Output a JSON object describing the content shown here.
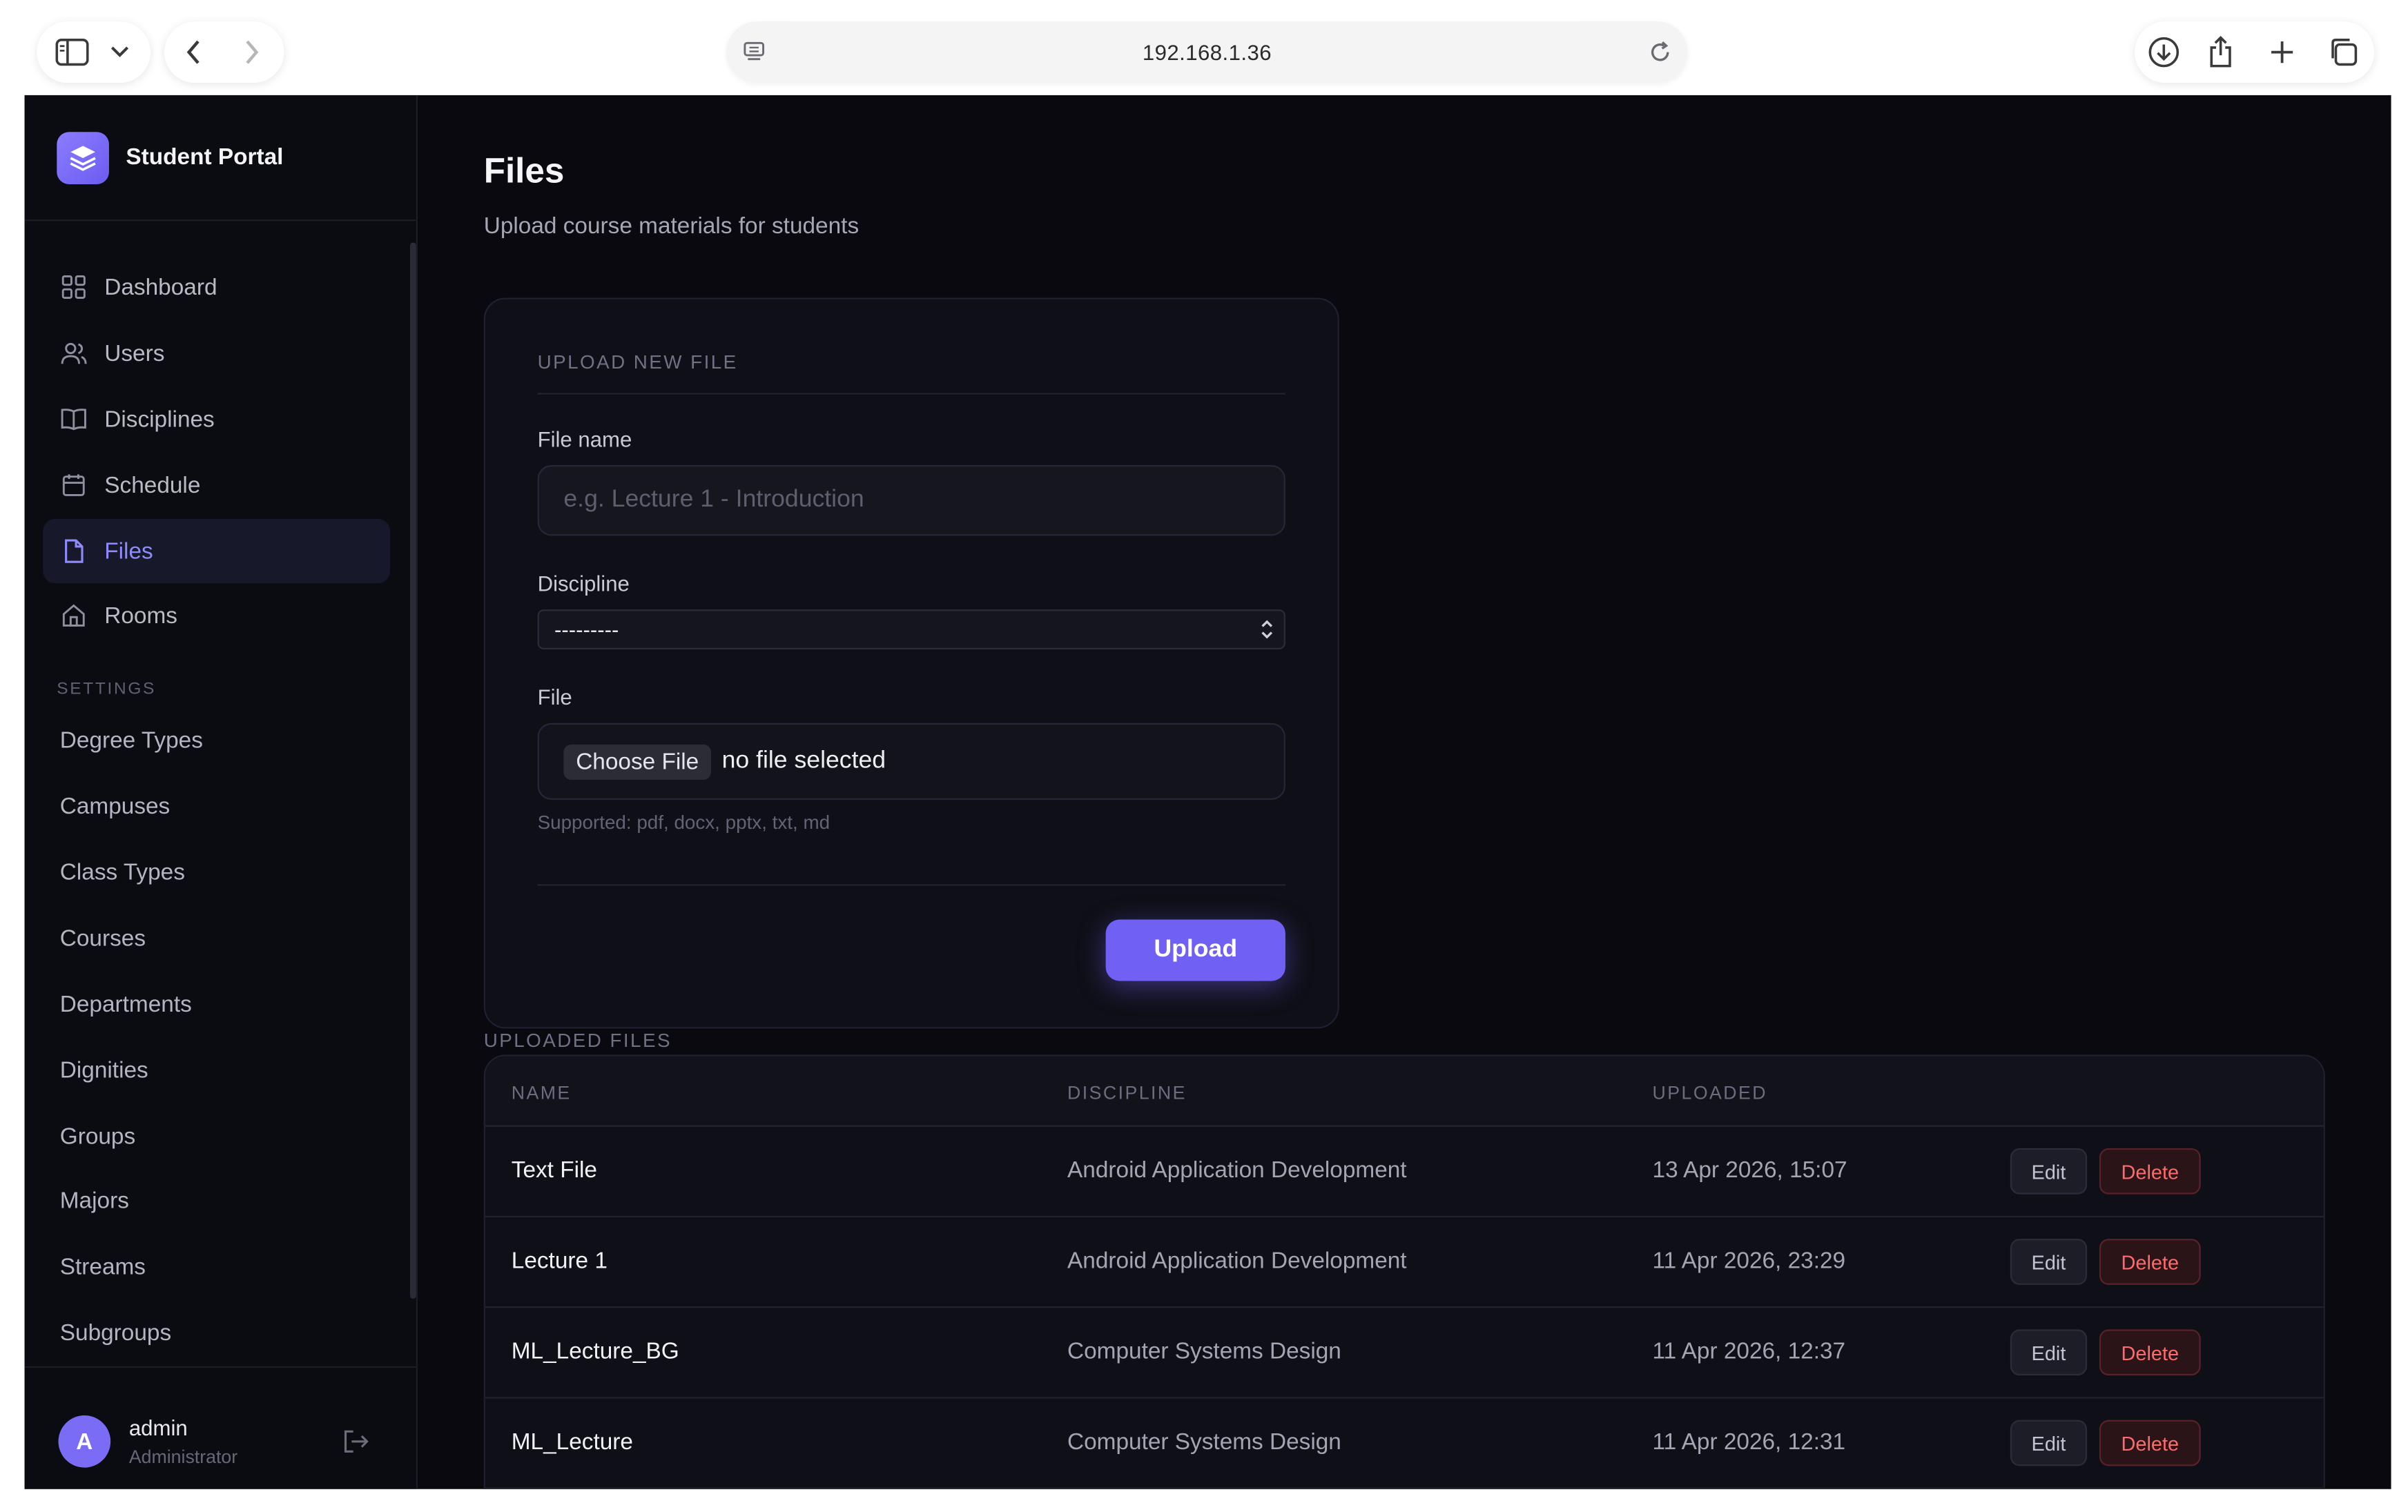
{
  "browser": {
    "url": "192.168.1.36"
  },
  "sidebar": {
    "brand": "Student Portal",
    "nav": [
      {
        "label": "Dashboard",
        "icon": "grid-icon"
      },
      {
        "label": "Users",
        "icon": "users-icon"
      },
      {
        "label": "Disciplines",
        "icon": "book-icon"
      },
      {
        "label": "Schedule",
        "icon": "calendar-icon"
      },
      {
        "label": "Files",
        "icon": "file-icon",
        "active": true
      },
      {
        "label": "Rooms",
        "icon": "home-icon"
      }
    ],
    "settings_title": "SETTINGS",
    "settings": [
      "Degree Types",
      "Campuses",
      "Class Types",
      "Courses",
      "Departments",
      "Dignities",
      "Groups",
      "Majors",
      "Streams",
      "Subgroups"
    ],
    "user": {
      "initial": "A",
      "name": "admin",
      "role": "Administrator"
    }
  },
  "main": {
    "title": "Files",
    "subtitle": "Upload course materials for students",
    "upload": {
      "section_title": "UPLOAD NEW FILE",
      "file_name_label": "File name",
      "file_name_placeholder": "e.g. Lecture 1 - Introduction",
      "discipline_label": "Discipline",
      "discipline_value": "---------",
      "file_label": "File",
      "choose_button": "Choose File",
      "no_file": "no file selected",
      "hint": "Supported: pdf, docx, pptx, txt, md",
      "upload_button": "Upload"
    },
    "uploaded_title": "UPLOADED FILES",
    "table": {
      "headers": [
        "NAME",
        "DISCIPLINE",
        "UPLOADED"
      ],
      "rows": [
        {
          "name": "Text File",
          "discipline": "Android Application Development",
          "uploaded": "13 Apr 2026, 15:07"
        },
        {
          "name": "Lecture 1",
          "discipline": "Android Application Development",
          "uploaded": "11 Apr 2026, 23:29"
        },
        {
          "name": "ML_Lecture_BG",
          "discipline": "Computer Systems Design",
          "uploaded": "11 Apr 2026, 12:37"
        },
        {
          "name": "ML_Lecture",
          "discipline": "Computer Systems Design",
          "uploaded": "11 Apr 2026, 12:31"
        }
      ],
      "edit_label": "Edit",
      "delete_label": "Delete"
    }
  },
  "colors": {
    "accent": "#7060f3",
    "background": "#09090f",
    "danger": "#ff6b6b"
  }
}
